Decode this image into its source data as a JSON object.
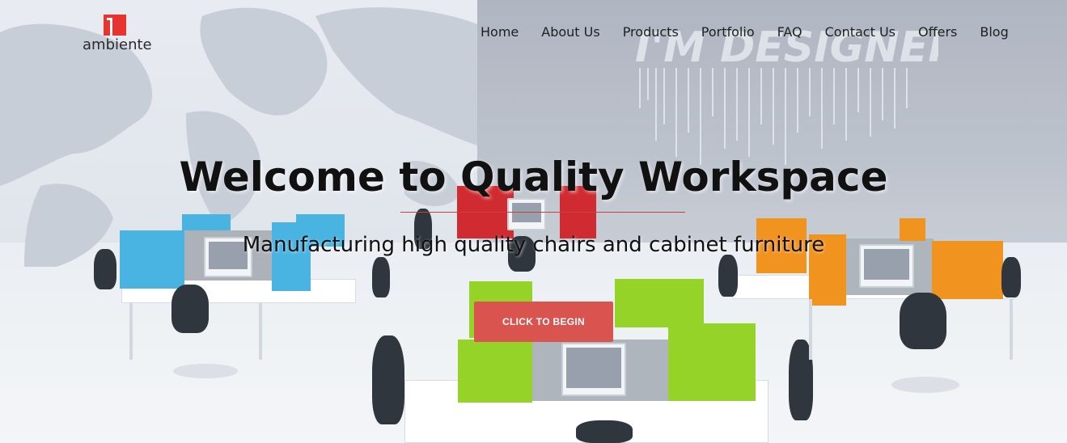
{
  "brand": {
    "name": "ambiente",
    "accent_color": "#e8332e",
    "logo_icon": "red-square-logo-icon"
  },
  "nav": {
    "items": [
      {
        "label": "Home"
      },
      {
        "label": "About Us"
      },
      {
        "label": "Products"
      },
      {
        "label": "Portfolio"
      },
      {
        "label": "FAQ"
      },
      {
        "label": "Contact Us"
      },
      {
        "label": "Offers"
      },
      {
        "label": "Blog"
      }
    ]
  },
  "hero": {
    "title": "Welcome to Quality Workspace",
    "subtitle": "Manufacturing high quality chairs and cabinet furniture",
    "cta_label": "CLICK TO BEGIN",
    "cta_color": "#d9534f",
    "wall_text": "I'M DESIGNER"
  }
}
